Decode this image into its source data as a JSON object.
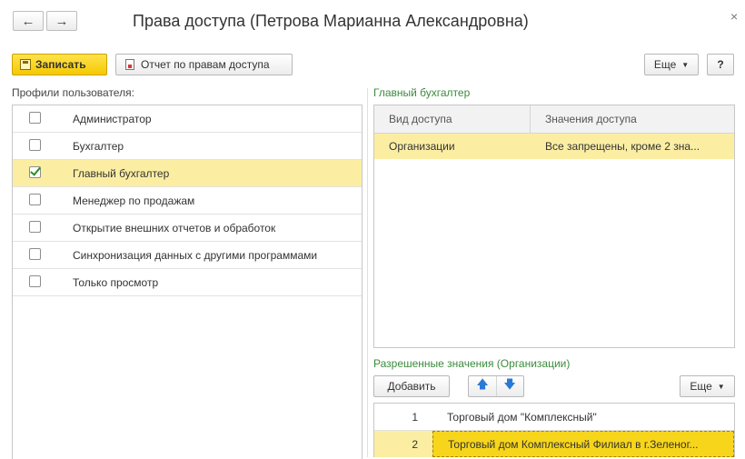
{
  "window": {
    "title": "Права доступа (Петрова Марианна Александровна)",
    "close_glyph": "×",
    "back_glyph": "←",
    "forward_glyph": "→"
  },
  "toolbar": {
    "save_label": "Записать",
    "report_label": "Отчет по правам доступа",
    "more_label": "Еще",
    "help_label": "?"
  },
  "profiles": {
    "heading": "Профили пользователя:",
    "items": [
      {
        "label": "Администратор",
        "checked": false
      },
      {
        "label": "Бухгалтер",
        "checked": false
      },
      {
        "label": "Главный бухгалтер",
        "checked": true
      },
      {
        "label": "Менеджер по продажам",
        "checked": false
      },
      {
        "label": "Открытие внешних отчетов и обработок",
        "checked": false
      },
      {
        "label": "Синхронизация данных с другими программами",
        "checked": false
      },
      {
        "label": "Только просмотр",
        "checked": false
      }
    ]
  },
  "access": {
    "heading": "Главный бухгалтер",
    "columns": [
      "Вид доступа",
      "Значения доступа"
    ],
    "rows": [
      {
        "kind": "Организации",
        "values": "Все запрещены, кроме 2 зна..."
      }
    ]
  },
  "allowed": {
    "heading": "Разрешенные значения (Организации)",
    "add_label": "Добавить",
    "more_label": "Еще",
    "up_glyph": "🡅",
    "down_glyph": "🡇",
    "rows": [
      {
        "num": "1",
        "name": "Торговый дом \"Комплексный\""
      },
      {
        "num": "2",
        "name": "Торговый дом Комплексный Филиал в г.Зеленог..."
      }
    ]
  },
  "colors": {
    "primary": "#f5c800",
    "selection": "#fbeea3",
    "section_heading": "#3c8b3c",
    "checkmark": "#2e8b2e"
  }
}
